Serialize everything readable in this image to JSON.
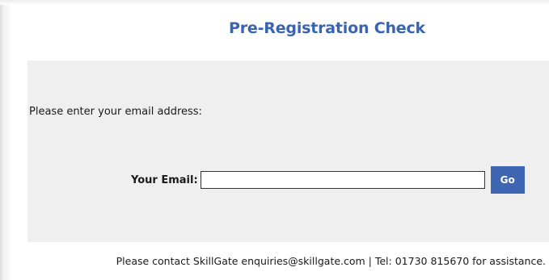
{
  "header": {
    "title": "Pre-Registration Check"
  },
  "form": {
    "prompt": "Please enter your email address:",
    "email_label": "Your Email:",
    "email_value": "",
    "email_placeholder": "",
    "go_label": "Go"
  },
  "footer": {
    "contact_text": "Please contact SkillGate enquiries@skillgate.com | Tel: 01730 815670 for assistance."
  },
  "colors": {
    "title": "#3a63b3",
    "button": "#3e66b2",
    "panel_background": "#efefef"
  }
}
